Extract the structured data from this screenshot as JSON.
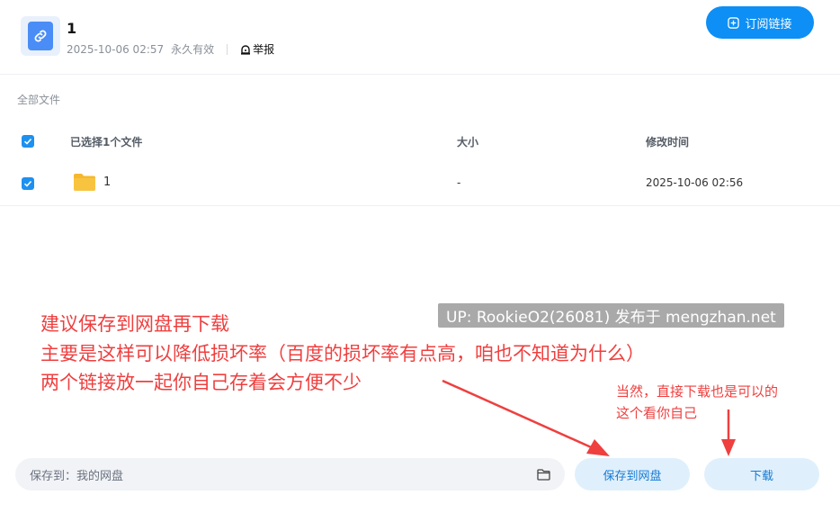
{
  "header": {
    "title": "1",
    "date": "2025-10-06 02:57",
    "validity": "永久有效",
    "report_label": "举报",
    "subscribe_label": "订阅链接"
  },
  "list": {
    "breadcrumb": "全部文件",
    "columns": {
      "name": "已选择1个文件",
      "size": "大小",
      "modified": "修改时间"
    },
    "rows": [
      {
        "name": "1",
        "size": "-",
        "modified": "2025-10-06 02:56",
        "checked": true,
        "icon": "folder-icon"
      }
    ]
  },
  "annotations": {
    "main": [
      "建议保存到网盘再下载",
      "主要是这样可以降低损坏率（百度的损坏率有点高，咱也不知道为什么）",
      "两个链接放一起你自己存着会方便不少"
    ],
    "side": [
      "当然，直接下载也是可以的",
      "这个看你自己"
    ],
    "watermark": "UP: RookieO2(26081) 发布于 mengzhan.net",
    "color": "#ef3f3f"
  },
  "footer": {
    "save_path_label": "保存到：我的网盘",
    "save_button": "保存到网盘",
    "download_button": "下载"
  },
  "colors": {
    "primary": "#0d8ff5",
    "light_button": "#dff0fc",
    "folder": "#f8c440"
  }
}
